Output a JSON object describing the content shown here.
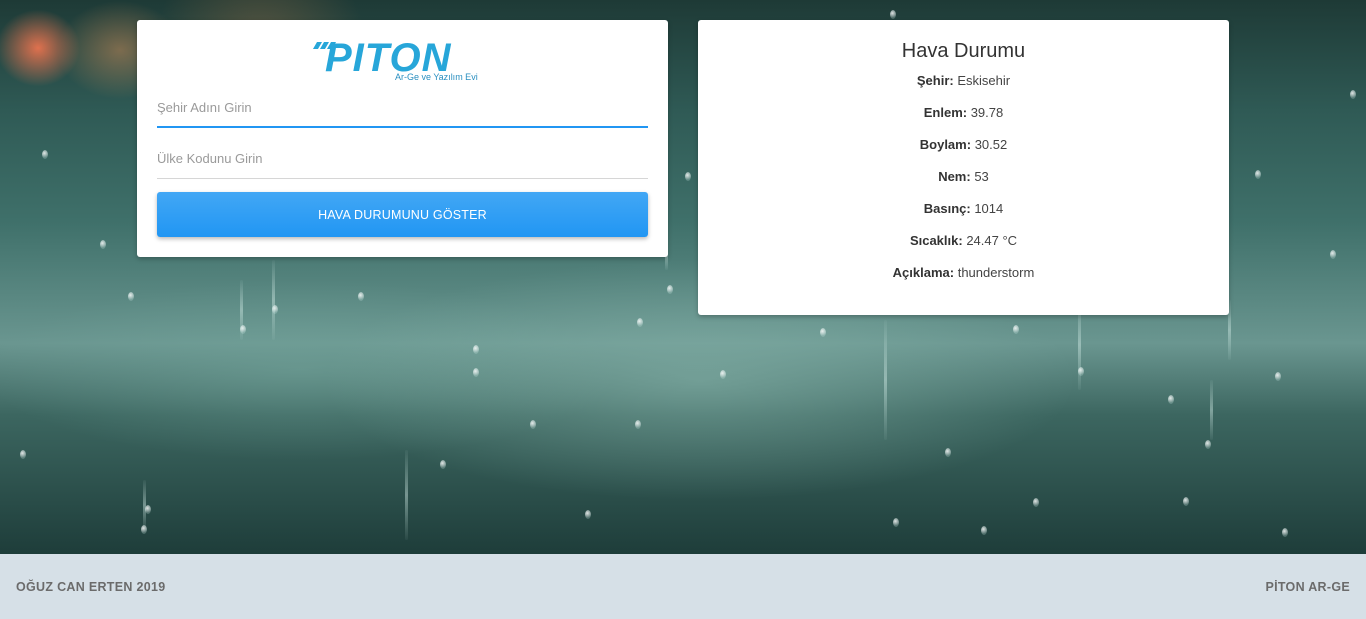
{
  "logo": {
    "text": "PITON",
    "subtitle": "Ar-Ge ve Yazılım Evi",
    "color": "#27a6d9"
  },
  "form": {
    "city_placeholder": "Şehir Adını Girin",
    "country_placeholder": "Ülke Kodunu Girin",
    "submit_label": "HAVA DURUMUNU GÖSTER",
    "accent_color": "#2196f3"
  },
  "weather": {
    "title": "Hava Durumu",
    "rows": [
      {
        "label": "Şehir:",
        "value": "Eskisehir"
      },
      {
        "label": "Enlem:",
        "value": "39.78"
      },
      {
        "label": "Boylam:",
        "value": "30.52"
      },
      {
        "label": "Nem:",
        "value": "53"
      },
      {
        "label": "Basınç:",
        "value": "1014"
      },
      {
        "label": "Sıcaklık:",
        "value": "24.47 °C"
      },
      {
        "label": "Açıklama:",
        "value": "thunderstorm"
      }
    ]
  },
  "footer": {
    "left_text": "OĞUZ CAN ERTEN 2019",
    "right_text": "PİTON AR-GE"
  }
}
